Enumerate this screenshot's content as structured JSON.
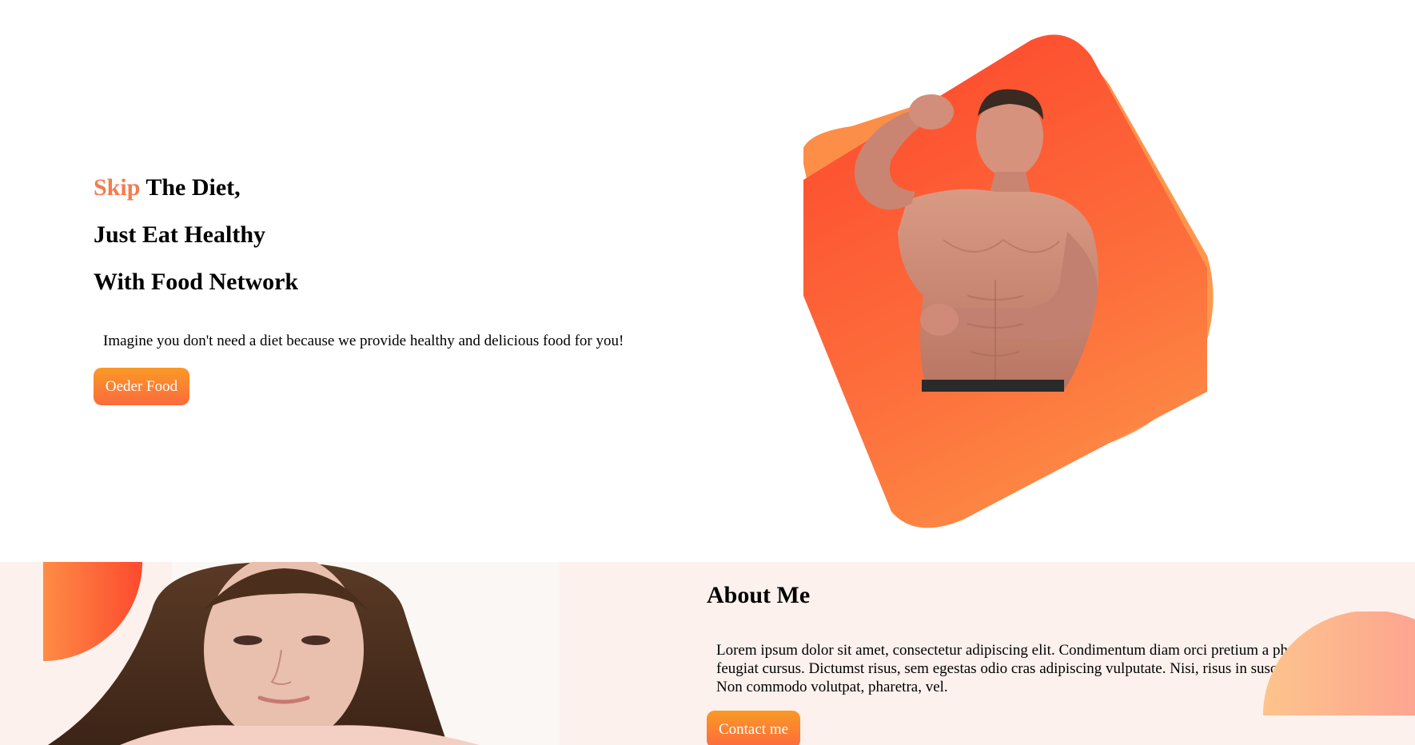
{
  "hero": {
    "accent_word": "Skip",
    "line1_rest": " The Diet,",
    "line2": "Just Eat Healthy",
    "line3": "With Food Network",
    "description": "Imagine you don't need a diet because we provide healthy and delicious food for you!",
    "button_label": "Oeder Food"
  },
  "about": {
    "title": "About Me",
    "text": "Lorem ipsum dolor sit amet, consectetur adipiscing elit. Condimentum diam orci pretium a pharetra, feugiat cursus. Dictumst risus, sem egestas odio cras adipiscing vulputate. Nisi, risus in suscipit non. Non commodo volutpat, pharetra, vel.",
    "button_label": "Contact me"
  },
  "images": {
    "hero_image": "muscular-man-flexing-photo",
    "about_image": "woman-portrait-photo"
  },
  "colors": {
    "accent": "#f47b4e",
    "button_start": "#fa9a25",
    "button_end": "#fc6a3d",
    "about_bg": "#fcf1ec"
  }
}
